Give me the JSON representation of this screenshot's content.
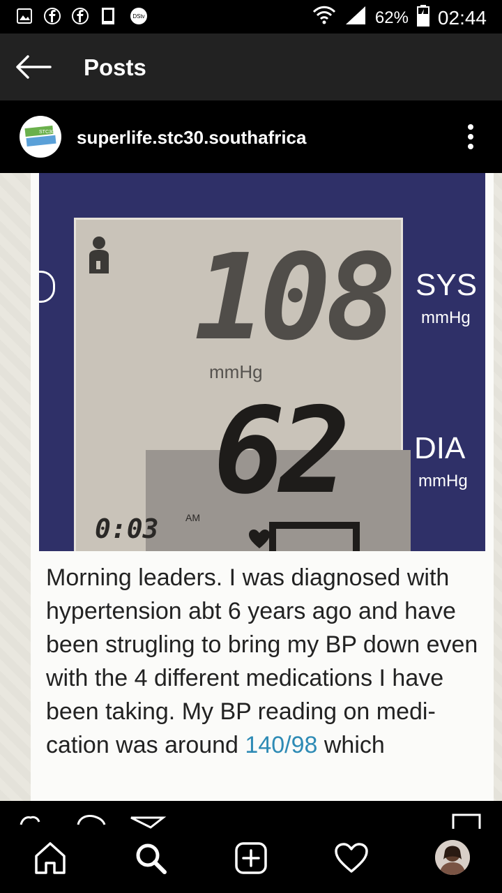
{
  "status_bar": {
    "battery_percent": "62%",
    "time": "02:44",
    "notification_icons": [
      "gallery-icon",
      "facebook-icon",
      "facebook-icon",
      "sd-card-icon",
      "dstv-icon"
    ],
    "dstv_label": "DStv"
  },
  "app_bar": {
    "title": "Posts"
  },
  "post": {
    "username": "superlife.stc30.southafrica",
    "brand_label": "STC30",
    "image": {
      "sys_value": "108",
      "dia_value": "62",
      "sys_label": "SYS",
      "dia_label": "DIA",
      "unit": "mmHg",
      "lcd_time": "0:03",
      "lcd_am": "AM",
      "caption_before": "Morning leaders. I was diagnosed with hypertension abt 6 years ago and have been strugling to bring my BP down even with the 4 different medications I have been taking. My BP reading on medi-cation was around ",
      "caption_highlight": "140/98",
      "caption_after": " which"
    }
  },
  "bottom_nav": {
    "items": [
      "home-icon",
      "search-icon",
      "new-post-icon",
      "activity-heart-icon",
      "profile-avatar"
    ]
  }
}
